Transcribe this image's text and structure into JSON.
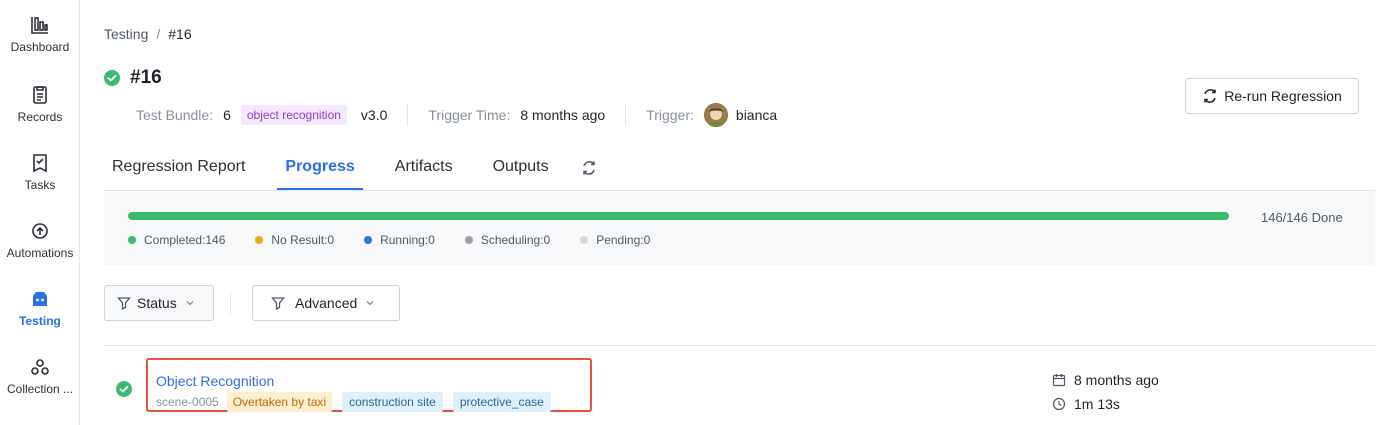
{
  "sidebar": {
    "items": [
      {
        "label": "Dashboard",
        "icon": "bar-chart-icon"
      },
      {
        "label": "Records",
        "icon": "clipboard-icon"
      },
      {
        "label": "Tasks",
        "icon": "task-icon"
      },
      {
        "label": "Automations",
        "icon": "automation-icon"
      },
      {
        "label": "Testing",
        "icon": "testing-icon",
        "active": true
      },
      {
        "label": "Collection ...",
        "icon": "collection-icon"
      }
    ]
  },
  "breadcrumb": {
    "parent": "Testing",
    "separator": "/",
    "current": "#16"
  },
  "header": {
    "title": "#16",
    "status": "success",
    "test_bundle_label": "Test Bundle:",
    "test_bundle_id": "6",
    "bundle_tag": "object recognition",
    "bundle_version": "v3.0",
    "trigger_time_label": "Trigger Time:",
    "trigger_time": "8 months ago",
    "trigger_label": "Trigger:",
    "trigger_user": "bianca",
    "rerun_label": "Re-run Regression"
  },
  "tabs": [
    {
      "label": "Regression Report"
    },
    {
      "label": "Progress",
      "active": true
    },
    {
      "label": "Artifacts"
    },
    {
      "label": "Outputs"
    }
  ],
  "progress": {
    "fraction": 1.0,
    "done_text": "146/146 Done",
    "legend": [
      {
        "label": "Completed:146",
        "color": "#3dba72"
      },
      {
        "label": "No Result:0",
        "color": "#e8b007"
      },
      {
        "label": "Running:0",
        "color": "#2f6fe6"
      },
      {
        "label": "Scheduling:0",
        "color": "#9a9ea6"
      },
      {
        "label": "Pending:0",
        "color": "#d3d6db"
      }
    ]
  },
  "filters": {
    "status_label": "Status",
    "advanced_label": "Advanced"
  },
  "results": [
    {
      "title": "Object Recognition",
      "scene_id": "scene-0005",
      "tags": [
        {
          "label": "Overtaken by taxi",
          "kind": "orange"
        },
        {
          "label": "construction site",
          "kind": "blue"
        },
        {
          "label": "protective_case",
          "kind": "blue"
        }
      ],
      "time": "8 months ago",
      "duration": "1m 13s"
    }
  ],
  "colors": {
    "accent": "#2a6fe8",
    "success": "#3dba72",
    "highlight_border": "#e5533b"
  }
}
